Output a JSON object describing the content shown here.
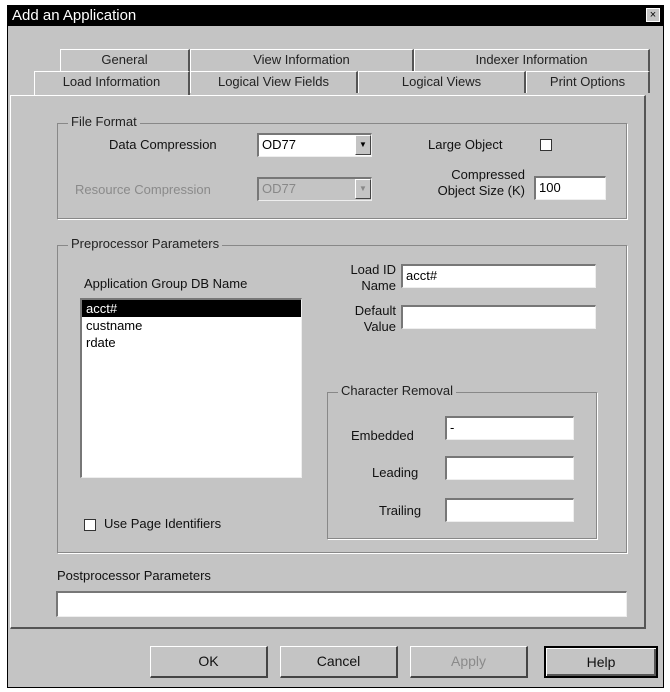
{
  "window": {
    "title": "Add an Application",
    "close_glyph": "×"
  },
  "tabs_row1": [
    "General",
    "View Information",
    "Indexer Information"
  ],
  "tabs_row2": [
    "Load Information",
    "Logical View Fields",
    "Logical Views",
    "Print Options"
  ],
  "file_format": {
    "legend": "File Format",
    "data_compression_label": "Data Compression",
    "data_compression_value": "OD77",
    "resource_compression_label": "Resource Compression",
    "resource_compression_value": "OD77",
    "large_object_label": "Large Object",
    "compressed_size_label_1": "Compressed",
    "compressed_size_label_2": "Object Size (K)",
    "compressed_size_value": "100"
  },
  "preprocessor": {
    "legend": "Preprocessor Parameters",
    "db_name_label": "Application Group DB Name",
    "db_names": [
      "acct#",
      "custname",
      "rdate"
    ],
    "load_id_label_1": "Load ID",
    "load_id_label_2": "Name",
    "load_id_value": "acct#",
    "default_label_1": "Default",
    "default_label_2": "Value",
    "default_value": "",
    "use_page_identifiers_label": "Use Page Identifiers"
  },
  "character_removal": {
    "legend": "Character Removal",
    "embedded_label": "Embedded",
    "embedded_value": "-",
    "leading_label": "Leading",
    "leading_value": "",
    "trailing_label": "Trailing",
    "trailing_value": ""
  },
  "postprocessor": {
    "label": "Postprocessor Parameters",
    "value": ""
  },
  "buttons": {
    "ok": "OK",
    "cancel": "Cancel",
    "apply": "Apply",
    "help": "Help"
  }
}
